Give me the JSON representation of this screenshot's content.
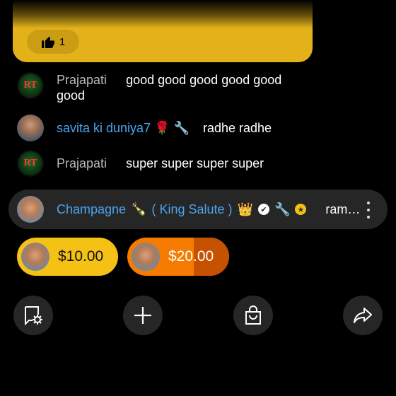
{
  "top_card": {
    "like_count": "1",
    "bg": "#e3b21a"
  },
  "comments": [
    {
      "name": "Prajapati",
      "message": "good good good good good good"
    },
    {
      "name": "savita ki duniya7",
      "message": "radhe radhe"
    },
    {
      "name": "Prajapati",
      "message": "super super super super"
    }
  ],
  "avatars": {
    "rt_letters": "RT"
  },
  "pinned": {
    "name": "Champagne",
    "name_suffix": "( King Salute )",
    "message": "ram…",
    "emoji": {
      "bottle": "🍾",
      "crown": "👑",
      "rose": "🌹",
      "wrench": "🔧",
      "check": "✔",
      "star": "★"
    }
  },
  "super_chats": [
    {
      "amount": "$10.00",
      "color": "#f4c114"
    },
    {
      "amount": "$20.00",
      "color": "#f57c00"
    }
  ],
  "actions": [
    "feedback-settings-icon",
    "plus-icon",
    "shopping-bag-icon",
    "share-icon"
  ]
}
